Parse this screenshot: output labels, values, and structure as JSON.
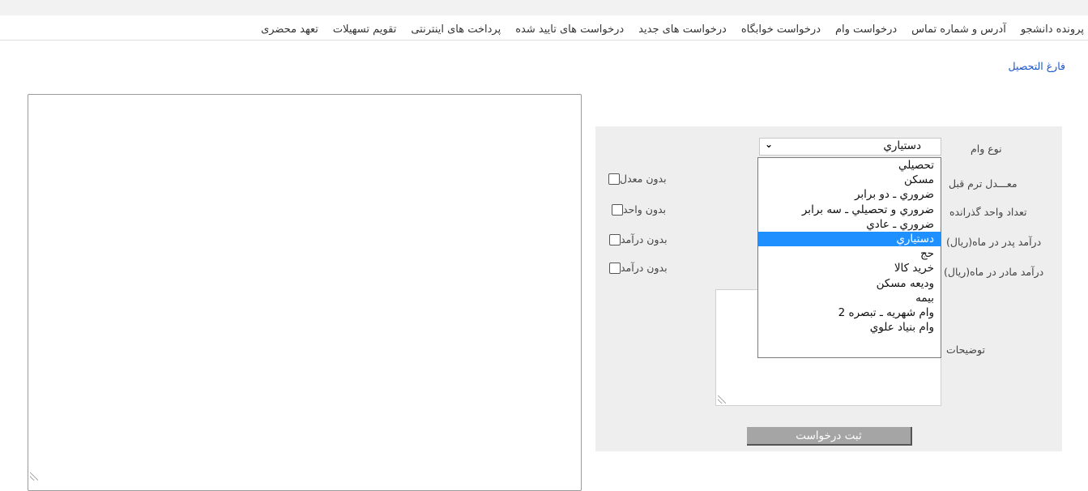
{
  "nav": {
    "items": [
      "پرونده دانشجو",
      "آدرس و شماره تماس",
      "درخواست وام",
      "درخواست خوابگاه",
      "درخواست های جدید",
      "درخواست های تایید شده",
      "پرداخت های اینترنتی",
      "تقویم تسهیلات",
      "تعهد محضری"
    ]
  },
  "status_link": "فارغ التحصیل",
  "form": {
    "loan_type_label": "نوع وام",
    "gpa_label": "معـــدل ترم قبل",
    "units_label": "تعداد واحد گذرانده",
    "father_income_label": "درآمد پدر در ماه(ریال)",
    "mother_income_label": "درآمد مادر در ماه(ریال)",
    "description_label": "توضیحات",
    "no_gpa": "بدون معدل",
    "no_units": "بدون واحد",
    "no_income_father": "بدون درآمد",
    "no_income_mother": "بدون درآمد",
    "loan_type_value": "دستياري",
    "loan_type_options": [
      "تحصيلي",
      "مسكن",
      "ضروري ـ دو برابر",
      "ضروري و تحصيلي ـ سه برابر",
      "ضروري ـ عادي",
      "دستياري",
      "حج",
      "خريد كالا",
      "وديعه مسكن",
      "بيمه",
      "وام شهريه ـ تبصره 2",
      "وام بنياد علوي"
    ],
    "selected_index": 5,
    "submit_label": "ثبت درخواست"
  }
}
